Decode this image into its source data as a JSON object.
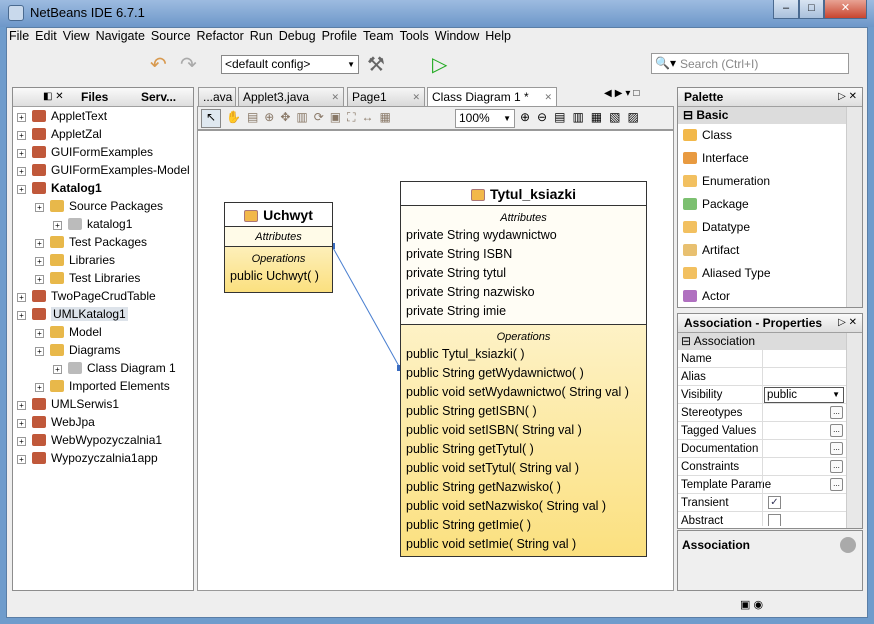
{
  "window": {
    "title": "NetBeans IDE 6.7.1"
  },
  "menu": [
    "File",
    "Edit",
    "View",
    "Navigate",
    "Source",
    "Refactor",
    "Run",
    "Debug",
    "Profile",
    "Team",
    "Tools",
    "Window",
    "Help"
  ],
  "toolbar": {
    "config": "<default config>",
    "search_placeholder": "Search (Ctrl+I)"
  },
  "left": {
    "tabs": [
      "Files",
      "Serv..."
    ],
    "tree": [
      {
        "label": "AppletText",
        "level": 0
      },
      {
        "label": "AppletZal",
        "level": 0
      },
      {
        "label": "GUIFormExamples",
        "level": 0
      },
      {
        "label": "GUIFormExamples-Model",
        "level": 0
      },
      {
        "label": "Katalog1",
        "level": 0,
        "bold": true
      },
      {
        "label": "Source Packages",
        "level": 1
      },
      {
        "label": "katalog1",
        "level": 2
      },
      {
        "label": "Test Packages",
        "level": 1
      },
      {
        "label": "Libraries",
        "level": 1
      },
      {
        "label": "Test Libraries",
        "level": 1
      },
      {
        "label": "TwoPageCrudTable",
        "level": 0
      },
      {
        "label": "UMLKatalog1",
        "level": 0,
        "selected": true
      },
      {
        "label": "Model",
        "level": 1
      },
      {
        "label": "Diagrams",
        "level": 1
      },
      {
        "label": "Class Diagram 1",
        "level": 2
      },
      {
        "label": "Imported Elements",
        "level": 1
      },
      {
        "label": "UMLSerwis1",
        "level": 0
      },
      {
        "label": "WebJpa",
        "level": 0
      },
      {
        "label": "WebWypozyczalnia1",
        "level": 0
      },
      {
        "label": "Wypozyczalnia1app",
        "level": 0
      }
    ]
  },
  "editor": {
    "tabs": [
      "...ava",
      "Applet3.java",
      "Page1",
      "Class Diagram 1 *"
    ],
    "zoom": "100%"
  },
  "diagram": {
    "uchwyt": {
      "name": "Uchwyt",
      "attributes_label": "Attributes",
      "operations_label": "Operations",
      "operations": [
        "public Uchwyt(  )"
      ]
    },
    "tytul": {
      "name": "Tytul_ksiazki",
      "attributes_label": "Attributes",
      "attributes": [
        "private String wydawnictwo",
        "private String ISBN",
        "private String tytul",
        "private String nazwisko",
        "private String imie"
      ],
      "operations_label": "Operations",
      "operations": [
        "public Tytul_ksiazki(  )",
        "public String  getWydawnictwo(  )",
        "public void  setWydawnictwo( String val )",
        "public String  getISBN(  )",
        "public void  setISBN( String val )",
        "public String  getTytul(  )",
        "public void  setTytul( String val )",
        "public String  getNazwisko(  )",
        "public void  setNazwisko( String val )",
        "public String  getImie(  )",
        "public void  setImie( String val )"
      ]
    }
  },
  "palette": {
    "title": "Palette",
    "category": "Basic",
    "items": [
      "Class",
      "Interface",
      "Enumeration",
      "Package",
      "Datatype",
      "Artifact",
      "Aliased Type",
      "Actor"
    ]
  },
  "properties": {
    "title": "Association - Properties",
    "section": "Association",
    "rows": [
      "Name",
      "Alias",
      "Visibility",
      "Stereotypes",
      "Tagged Values",
      "Documentation",
      "Constraints",
      "Template Parame",
      "Transient",
      "Abstract"
    ],
    "visibility": "public",
    "transient": true,
    "abstract": false,
    "description": "Association"
  }
}
